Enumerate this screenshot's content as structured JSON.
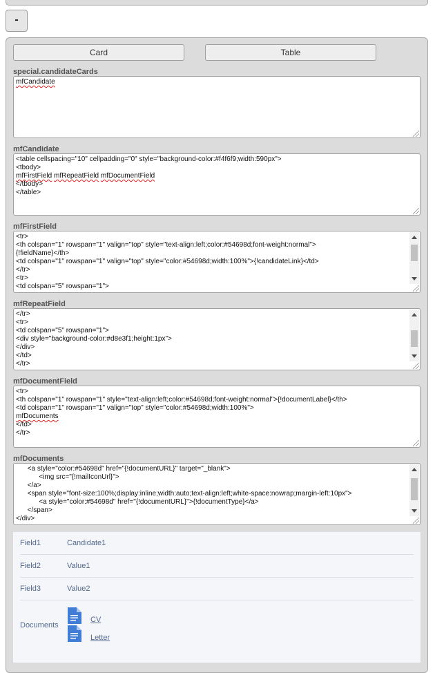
{
  "collapse_button": "-",
  "tabs": {
    "card": "Card",
    "table": "Table"
  },
  "fields": {
    "candidate_cards": {
      "label": "special.candidateCards",
      "value": "mfCandidate"
    },
    "mf_candidate": {
      "label": "mfCandidate",
      "lines": [
        "<table cellspacing=\"10\" cellpadding=\"0\" style=\"background-color:#f4f6f9;width:590px\">",
        "<tbody>",
        "mfFirstField",
        "mfRepeatField",
        "mfDocumentField",
        "</tbody>",
        "</table>"
      ]
    },
    "mf_first_field": {
      "label": "mfFirstField",
      "lines": [
        "<tr>",
        "<th colspan=\"1\" rowspan=\"1\" valign=\"top\" style=\"text-align:left;color:#54698d;font-weight:normal\">",
        "{!fieldName}</th>",
        "<td colspan=\"1\" rowspan=\"1\" valign=\"top\" style=\"color:#54698d;width:100%\">{!candidateLink}</td>",
        "</tr>",
        "<tr>",
        "<td colspan=\"5\" rowspan=\"1\">"
      ]
    },
    "mf_repeat_field": {
      "label": "mfRepeatField",
      "lines": [
        "</tr>",
        "<tr>",
        "<td colspan=\"5\" rowspan=\"1\">",
        "<div style=\"background-color:#d8e3f1;height:1px\">",
        "</div>",
        "</td>",
        "</tr>"
      ]
    },
    "mf_document_field": {
      "label": "mfDocumentField",
      "lines": [
        "<tr>",
        "<th colspan=\"1\" rowspan=\"1\" style=\"text-align:left;color:#54698d;font-weight:normal\">{!documentLabel}</th>",
        "<td colspan=\"1\" rowspan=\"1\" valign=\"top\" style=\"color:#54698d;width:100%\">",
        "mfDocuments",
        "</td>",
        "</tr>"
      ]
    },
    "mf_documents": {
      "label": "mfDocuments",
      "lines": [
        "      <a style=\"color:#54698d\" href=\"{!documentURL}\" target=\"_blank\">",
        "            <img src=\"{!mailIconUrl}\">",
        "      </a>",
        "      <span style=\"font-size:100%;display:inline;width:auto;text-align:left;white-space:nowrap;margin-left:10px\">",
        "            <a style=\"color:#54698d\" href=\"{!documentURL}\">{!documentType}</a>",
        "      </span>",
        "</div>"
      ]
    }
  },
  "card_preview": {
    "rows": [
      {
        "key": "Field1",
        "value": "Candidate1"
      },
      {
        "key": "Field2",
        "value": "Value1"
      },
      {
        "key": "Field3",
        "value": "Value2"
      }
    ],
    "documents_label": "Documents",
    "documents": [
      "CV",
      "Letter"
    ]
  },
  "colors": {
    "label_blue": "#54698d",
    "doc_icon": "#3f7dd6",
    "panel": "#dcdcdc"
  }
}
